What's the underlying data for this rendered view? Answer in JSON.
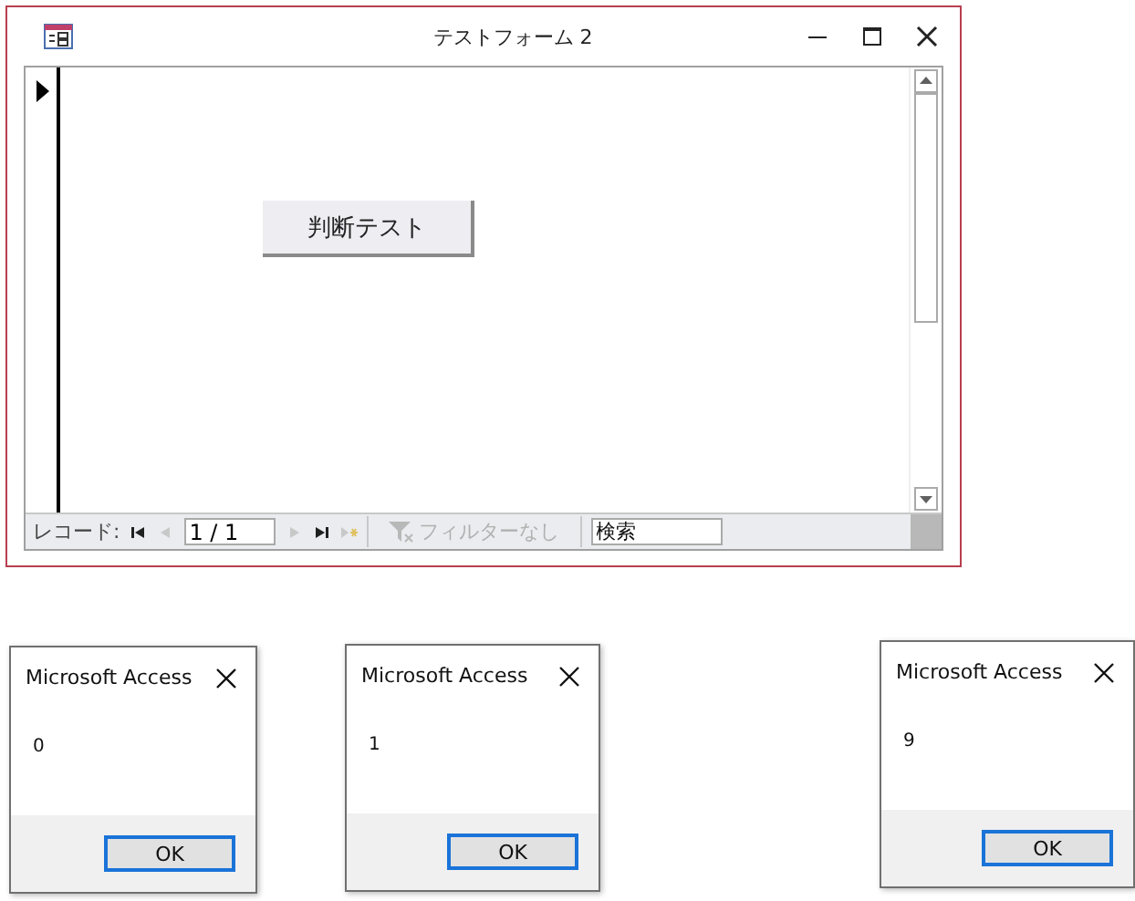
{
  "form_window": {
    "title": "テストフォーム 2",
    "button": {
      "label": "判断テスト"
    },
    "navigation": {
      "label": "レコード:",
      "record": "1 / 1",
      "buttons": [
        {
          "kind": "first",
          "disabled": false
        },
        {
          "kind": "prev",
          "disabled": true
        }
      ],
      "buttons_after": [
        {
          "kind": "next",
          "disabled": true
        },
        {
          "kind": "last",
          "disabled": false
        },
        {
          "kind": "new",
          "disabled": true
        }
      ],
      "filter": {
        "label": "フィルターなし",
        "disabled": true
      },
      "search": {
        "placeholder": "検索"
      }
    }
  },
  "dialogs": [
    {
      "title": "Microsoft Access",
      "message": "0",
      "button": "OK"
    },
    {
      "title": "Microsoft Access",
      "message": "1",
      "button": "OK"
    },
    {
      "title": "Microsoft Access",
      "message": "9",
      "button": "OK"
    }
  ]
}
